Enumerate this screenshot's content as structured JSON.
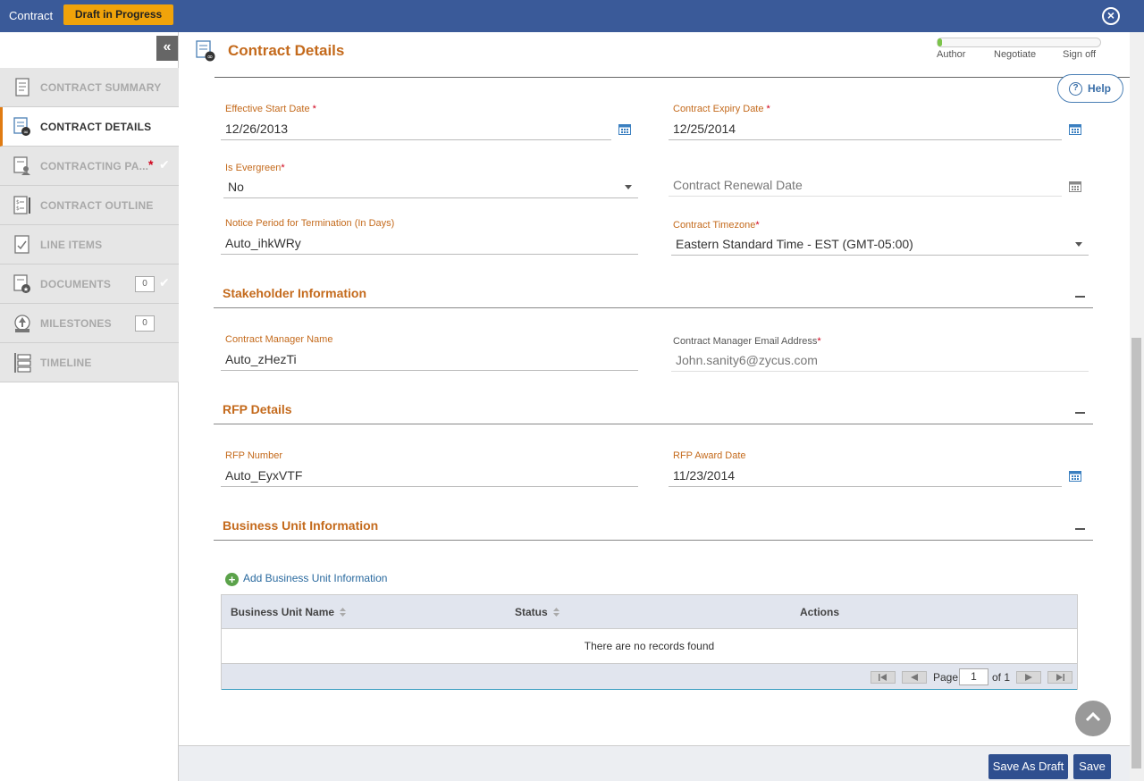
{
  "topbar": {
    "title": "Contract",
    "status_badge": "Draft in Progress",
    "close_icon": "close-icon"
  },
  "sidebar": {
    "collapse_icon": "double-chevron-left-icon",
    "items": [
      {
        "label": "CONTRACT SUMMARY",
        "icon": "summary-icon",
        "active": false
      },
      {
        "label": "CONTRACT DETAILS",
        "icon": "details-icon",
        "active": true
      },
      {
        "label": "CONTRACTING PA...",
        "icon": "parties-icon",
        "active": false,
        "required": "*",
        "complete": "✔"
      },
      {
        "label": "CONTRACT OUTLINE",
        "icon": "outline-icon",
        "active": false
      },
      {
        "label": "LINE ITEMS",
        "icon": "line-items-icon",
        "active": false
      },
      {
        "label": "DOCUMENTS",
        "icon": "documents-icon",
        "active": false,
        "count": "0",
        "complete": "✔"
      },
      {
        "label": "MILESTONES",
        "icon": "milestones-icon",
        "active": false,
        "count": "0"
      },
      {
        "label": "TIMELINE",
        "icon": "timeline-icon",
        "active": false
      }
    ]
  },
  "header": {
    "title": "Contract Details",
    "progress_fraction": 0.03,
    "stages": [
      "Author",
      "Negotiate",
      "Sign off"
    ],
    "help_label": "Help"
  },
  "contract_fields": {
    "effective_start_date": {
      "label": "Effective Start Date",
      "required": "*",
      "value": "12/26/2013"
    },
    "contract_expiry_date": {
      "label": "Contract Expiry Date",
      "required": "*",
      "value": "12/25/2014"
    },
    "is_evergreen": {
      "label": "Is Evergreen",
      "required": "*",
      "value": "No"
    },
    "contract_renewal_date": {
      "placeholder": "Contract Renewal Date"
    },
    "notice_period": {
      "label": "Notice Period for Termination (In Days)",
      "value": "Auto_ihkWRy"
    },
    "contract_timezone": {
      "label": "Contract Timezone",
      "required": "*",
      "value": "Eastern Standard Time - EST (GMT-05:00)"
    }
  },
  "stakeholder": {
    "title": "Stakeholder Information",
    "manager_name": {
      "label": "Contract Manager Name",
      "value": "Auto_zHezTi"
    },
    "manager_email": {
      "label": "Contract Manager Email Address",
      "required": "*",
      "value": "John.sanity6@zycus.com"
    }
  },
  "rfp": {
    "title": "RFP Details",
    "number": {
      "label": "RFP Number",
      "value": "Auto_EyxVTF"
    },
    "award_date": {
      "label": "RFP Award Date",
      "value": "11/23/2014"
    }
  },
  "business_unit": {
    "title": "Business Unit Information",
    "add_label": "Add Business Unit Information",
    "columns": [
      "Business Unit Name",
      "Status",
      "Actions"
    ],
    "empty_message": "There are no records found",
    "pager": {
      "page_label": "Page",
      "page_value": "1",
      "of_label": "of 1"
    }
  },
  "footer": {
    "save_draft_label": "Save As Draft",
    "save_label": "Save"
  },
  "colors": {
    "topbar": "#3a5a99",
    "accent_orange": "#c46a1c",
    "badge": "#f0a30a",
    "primary_button": "#2f4f8f",
    "progress_fill": "#7cc44a"
  }
}
